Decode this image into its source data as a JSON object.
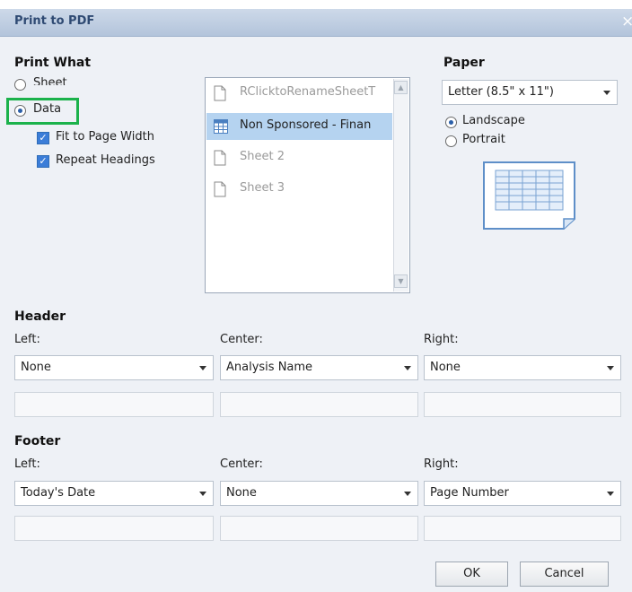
{
  "window": {
    "title": "Print to PDF",
    "close_glyph": "×"
  },
  "print_what": {
    "heading": "Print What",
    "options": [
      {
        "label": "Sheet",
        "selected": false
      },
      {
        "label": "Data",
        "selected": true
      }
    ],
    "checkboxes": [
      {
        "label": "Fit to Page Width",
        "checked": true
      },
      {
        "label": "Repeat Headings",
        "checked": true
      }
    ]
  },
  "sheets": [
    {
      "name": "RClicktoRenameSheetT",
      "icon": "sheet-icon",
      "selected": false
    },
    {
      "name": "Non Sponsored - Finan",
      "icon": "table-icon",
      "selected": true
    },
    {
      "name": "Sheet 2",
      "icon": "sheet-icon",
      "selected": false
    },
    {
      "name": "Sheet 3",
      "icon": "sheet-icon",
      "selected": false
    }
  ],
  "paper": {
    "heading": "Paper",
    "size": "Letter (8.5\" x 11\")",
    "orientation_options": [
      {
        "label": "Landscape",
        "selected": true
      },
      {
        "label": "Portrait",
        "selected": false
      }
    ],
    "preview_icon": "landscape-page-preview-icon"
  },
  "header": {
    "heading": "Header",
    "left_label": "Left:",
    "center_label": "Center:",
    "right_label": "Right:",
    "left_value": "None",
    "center_value": "Analysis Name",
    "right_value": "None"
  },
  "footer": {
    "heading": "Footer",
    "left_label": "Left:",
    "center_label": "Center:",
    "right_label": "Right:",
    "left_value": "Today's Date",
    "center_value": "None",
    "right_value": "Page Number"
  },
  "buttons": {
    "ok": "OK",
    "cancel": "Cancel"
  },
  "colors": {
    "selection": "#b5d3f0",
    "highlight_box": "#1bb24b",
    "checkbox": "#3b7dd8"
  }
}
